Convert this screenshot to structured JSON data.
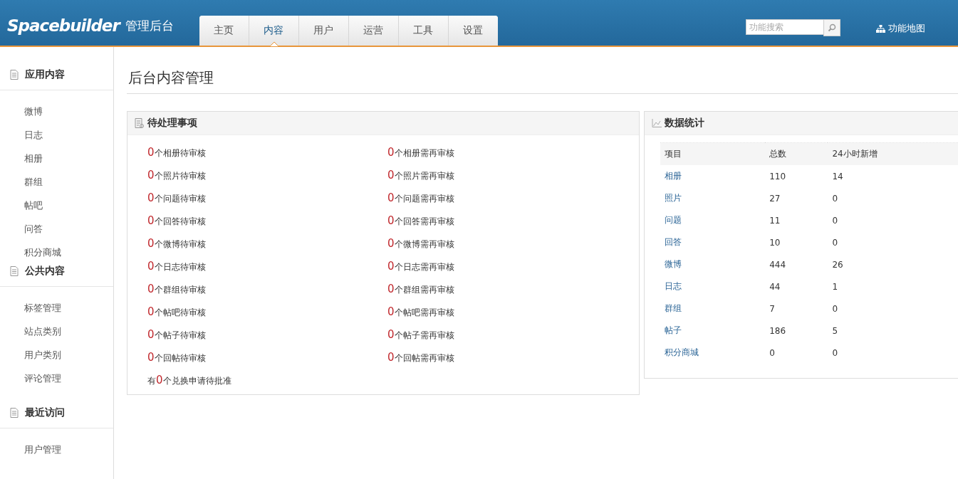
{
  "header": {
    "logo": "Spacebuilder",
    "subtitle": "管理后台",
    "tabs": [
      {
        "label": "主页",
        "selected": false
      },
      {
        "label": "内容",
        "selected": true
      },
      {
        "label": "用户",
        "selected": false
      },
      {
        "label": "运营",
        "selected": false
      },
      {
        "label": "工具",
        "selected": false
      },
      {
        "label": "设置",
        "selected": false
      }
    ],
    "search": {
      "placeholder": "功能搜索"
    },
    "sitemap": "功能地图"
  },
  "sidebar": [
    {
      "title": "应用内容",
      "items": [
        "微博",
        "日志",
        "相册",
        "群组",
        "帖吧",
        "问答",
        "积分商城"
      ]
    },
    {
      "title": "公共内容",
      "items": [
        "标签管理",
        "站点类别",
        "用户类别",
        "评论管理"
      ]
    },
    {
      "title": "最近访问",
      "items": [
        "用户管理"
      ]
    }
  ],
  "page_title": "后台内容管理",
  "pending": {
    "title": "待处理事项",
    "items": [
      {
        "count": "0",
        "text": "个相册待审核"
      },
      {
        "count": "0",
        "text": "个相册需再审核"
      },
      {
        "count": "0",
        "text": "个照片待审核"
      },
      {
        "count": "0",
        "text": "个照片需再审核"
      },
      {
        "count": "0",
        "text": "个问题待审核"
      },
      {
        "count": "0",
        "text": "个问题需再审核"
      },
      {
        "count": "0",
        "text": "个回答待审核"
      },
      {
        "count": "0",
        "text": "个回答需再审核"
      },
      {
        "count": "0",
        "text": "个微博待审核"
      },
      {
        "count": "0",
        "text": "个微博需再审核"
      },
      {
        "count": "0",
        "text": "个日志待审核"
      },
      {
        "count": "0",
        "text": "个日志需再审核"
      },
      {
        "count": "0",
        "text": "个群组待审核"
      },
      {
        "count": "0",
        "text": "个群组需再审核"
      },
      {
        "count": "0",
        "text": "个帖吧待审核"
      },
      {
        "count": "0",
        "text": "个帖吧需再审核"
      },
      {
        "count": "0",
        "text": "个帖子待审核"
      },
      {
        "count": "0",
        "text": "个帖子需再审核"
      },
      {
        "count": "0",
        "text": "个回帖待审核"
      },
      {
        "count": "0",
        "text": "个回帖需再审核"
      }
    ],
    "footer": {
      "prefix": "有",
      "count": "0",
      "text": "个兑换申请待批准"
    }
  },
  "stats": {
    "title": "数据统计",
    "columns": [
      "项目",
      "总数",
      "24小时新增"
    ],
    "rows": [
      [
        "相册",
        "110",
        "14"
      ],
      [
        "照片",
        "27",
        "0"
      ],
      [
        "问题",
        "11",
        "0"
      ],
      [
        "回答",
        "10",
        "0"
      ],
      [
        "微博",
        "444",
        "26"
      ],
      [
        "日志",
        "44",
        "1"
      ],
      [
        "群组",
        "7",
        "0"
      ],
      [
        "帖子",
        "186",
        "5"
      ],
      [
        "积分商城",
        "0",
        "0"
      ]
    ]
  }
}
